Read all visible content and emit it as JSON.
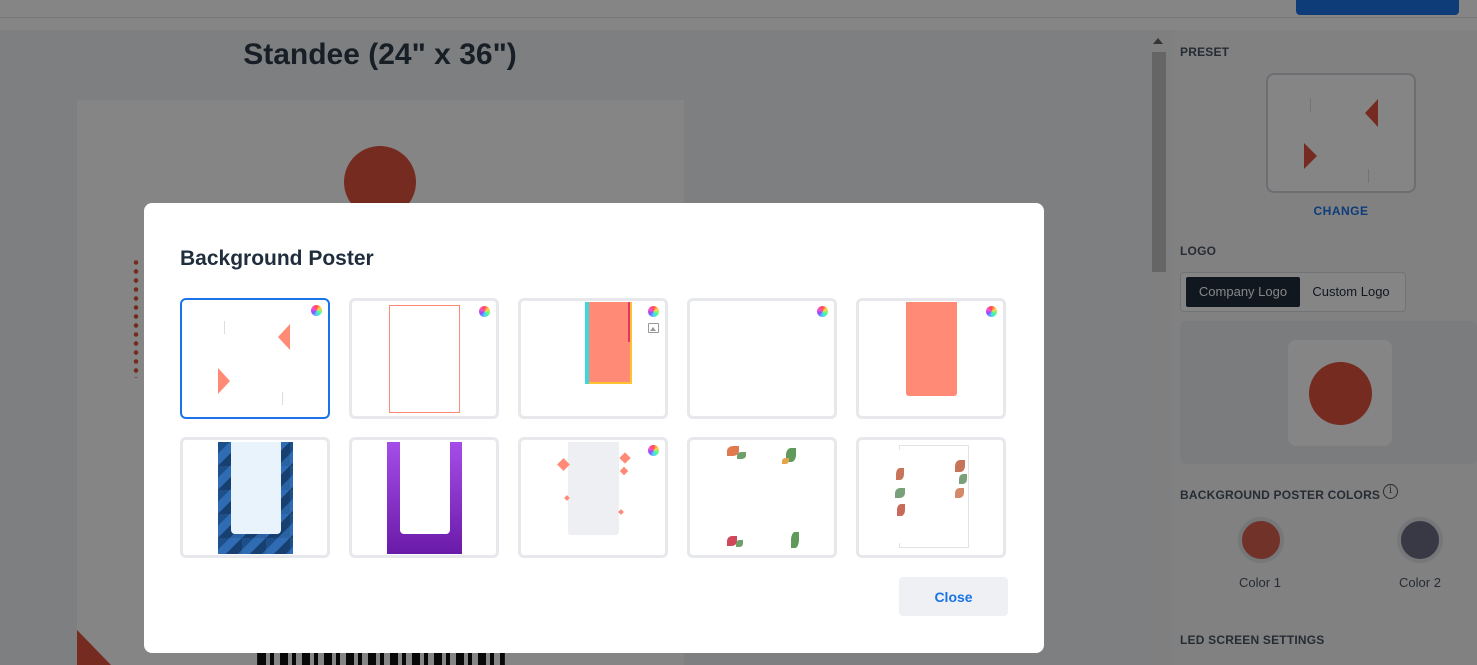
{
  "canvas": {
    "poster_title": "Standee (24\" x 36\")"
  },
  "sidebar": {
    "preset_label": "PRESET",
    "change_label": "CHANGE",
    "logo_label": "LOGO",
    "logo_tabs": [
      "Company Logo",
      "Custom Logo"
    ],
    "logo_tab_selected": "Company Logo",
    "bg_colors_label": "BACKGROUND POSTER COLORS",
    "info_icon": "info-icon",
    "colors": [
      {
        "label": "Color 1",
        "hex": "#d9614f"
      },
      {
        "label": "Color 2",
        "hex": "#6c6d85"
      }
    ],
    "led_label": "LED SCREEN SETTINGS"
  },
  "modal": {
    "title": "Background Poster",
    "close_label": "Close",
    "selected_index": 0,
    "posters": [
      {
        "style": "triangles",
        "color_option": true,
        "image_option": false
      },
      {
        "style": "outline-frame",
        "color_option": true,
        "image_option": false
      },
      {
        "style": "color-block-accent",
        "color_option": true,
        "image_option": true
      },
      {
        "style": "blank",
        "color_option": true,
        "image_option": false
      },
      {
        "style": "solid-panel",
        "color_option": true,
        "image_option": false
      },
      {
        "style": "blue-geometric",
        "color_option": false,
        "image_option": false
      },
      {
        "style": "purple-gradient",
        "color_option": false,
        "image_option": false
      },
      {
        "style": "diamonds",
        "color_option": true,
        "image_option": false
      },
      {
        "style": "floral-corners",
        "color_option": false,
        "image_option": false
      },
      {
        "style": "floral-sides",
        "color_option": false,
        "image_option": false
      }
    ]
  },
  "colors": {
    "accent": "#1a73e8",
    "brand": "#e0533f",
    "poster_coral": "#ff8a75"
  }
}
